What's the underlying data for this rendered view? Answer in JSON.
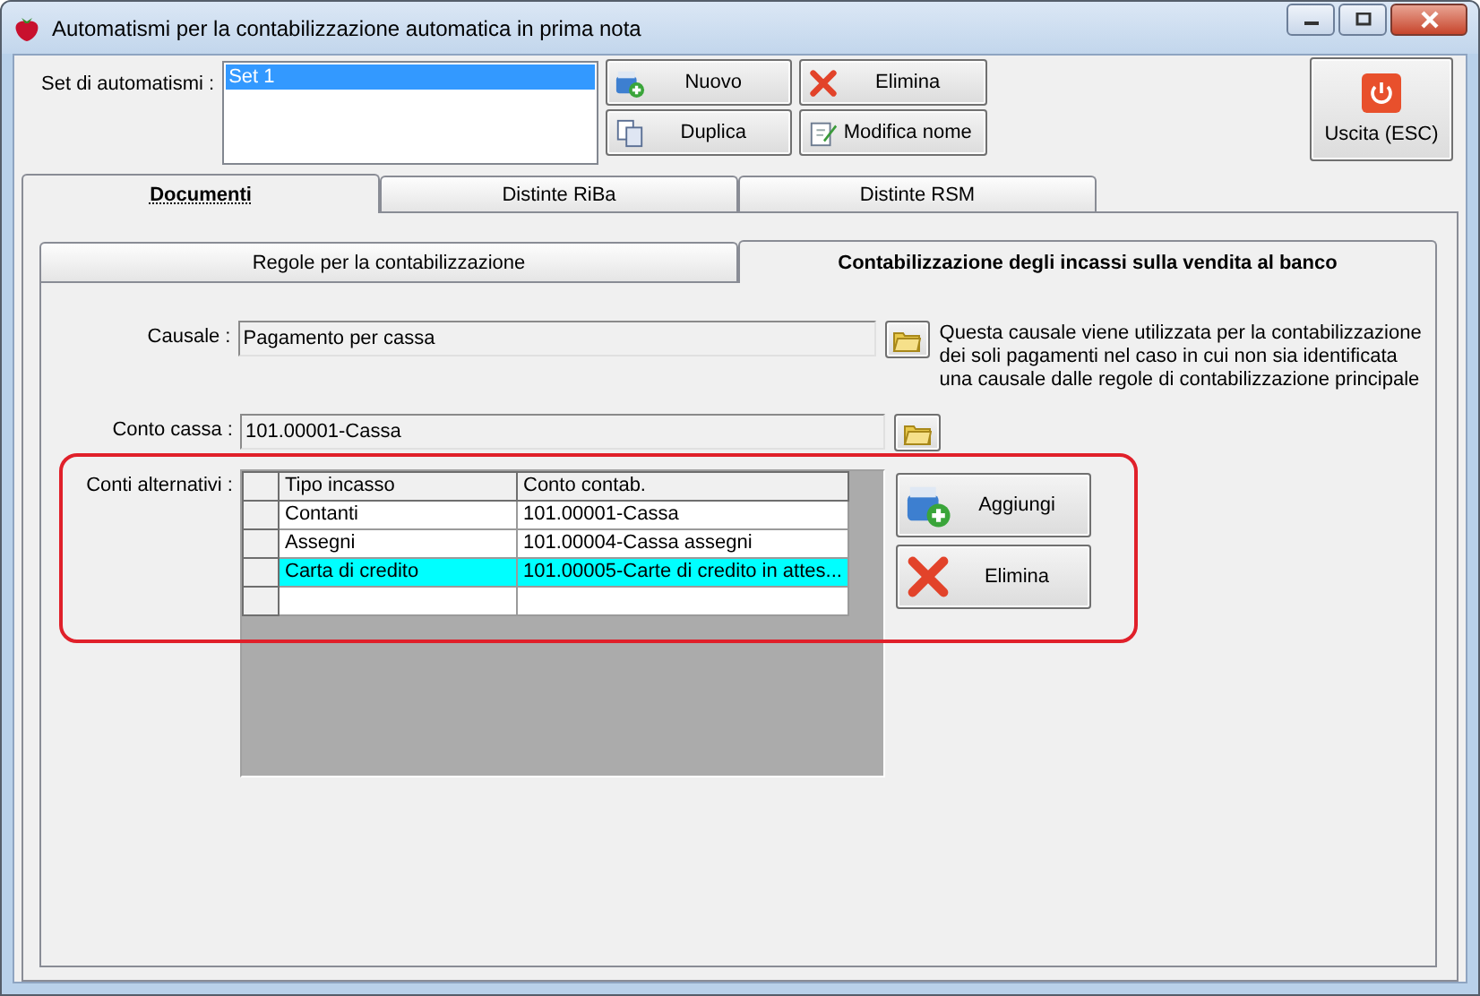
{
  "window": {
    "title": "Automatismi per la contabilizzazione automatica in prima nota"
  },
  "set_list": {
    "label": "Set di automatismi :",
    "items": [
      {
        "text": "Set 1",
        "selected": true
      }
    ]
  },
  "buttons": [
    {
      "label": "Nuovo",
      "kind": "new"
    },
    {
      "label": "Elimina",
      "kind": "delete"
    },
    {
      "label": "Duplica",
      "kind": "copy"
    },
    {
      "label": "Modifica nome",
      "kind": "rename"
    }
  ],
  "exit_button": {
    "label": "Uscita (ESC)"
  },
  "tabs": [
    {
      "label": "Documenti",
      "selected": true
    },
    {
      "label": "Distinte RiBa",
      "selected": false
    },
    {
      "label": "Distinte RSM",
      "selected": false
    }
  ],
  "subtabs": [
    {
      "label": "Regole per la contabilizzazione",
      "selected": false
    },
    {
      "label": "Contabilizzazione degli incassi sulla vendita al banco",
      "selected": true
    }
  ],
  "causale": {
    "label": "Causale :",
    "value": "Pagamento per cassa",
    "note": "Questa causale viene utilizzata per la contabilizzazione dei soli pagamenti nel caso in cui non sia identificata una causale dalle regole di contabilizzazione principale"
  },
  "conto_cassa": {
    "label": "Conto cassa :",
    "value": "101.00001-Cassa"
  },
  "conti_alternativi": {
    "label": "Conti alternativi :",
    "columns": [
      "Tipo incasso",
      "Conto contab."
    ],
    "rows": [
      {
        "cells": [
          "Contanti",
          "101.00001-Cassa"
        ],
        "selected": false
      },
      {
        "cells": [
          "Assegni",
          "101.00004-Cassa assegni"
        ],
        "selected": false
      },
      {
        "cells": [
          "Carta di credito",
          "101.00005-Carte di credito in attes..."
        ],
        "selected": true
      }
    ],
    "buttons": [
      {
        "label": "Aggiungi",
        "kind": "new"
      },
      {
        "label": "Elimina",
        "kind": "delete"
      }
    ]
  }
}
